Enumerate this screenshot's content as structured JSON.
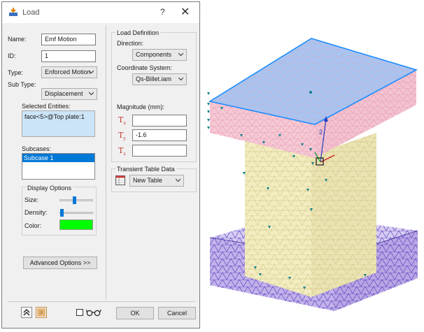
{
  "dialog": {
    "title": "Load",
    "help_glyph": "?",
    "close_glyph": "✕",
    "name_label": "Name:",
    "name_value": "Emf Motion",
    "id_label": "ID:",
    "id_value": "1",
    "type_label": "Type:",
    "type_value": "Enforced Motion",
    "subtype_label": "Sub Type:",
    "subtype_value": "Displacement",
    "selected_entities_label": "Selected Entities:",
    "selected_entities_value": "face<5>@Top plate:1",
    "subcases_label": "Subcases:",
    "subcases_items": [
      "Subcase 1"
    ],
    "display_options_label": "Display Options",
    "size_label": "Size:",
    "size_level": 0.45,
    "density_label": "Density:",
    "density_level": 0.02,
    "color_label": "Color:",
    "color_value": "#00ff00",
    "advanced_button": "Advanced Options >>",
    "load_definition_label": "Load Definition",
    "direction_label": "Direction:",
    "direction_value": "Components",
    "coord_system_label": "Coordinate System:",
    "coord_system_value": "Qs-Billet.iam",
    "magnitude_label": "Magnitude (mm):",
    "tx_label": "T",
    "tx_sub": "x",
    "tx_value": "",
    "ty_label": "T",
    "ty_sub": "y",
    "ty_value": "-1.6",
    "tz_label": "T",
    "tz_sub": "z",
    "tz_value": "",
    "transient_label": "Transient Table Data",
    "table_value": "New Table",
    "ok_button": "OK",
    "cancel_button": "Cancel"
  },
  "viewport": {
    "axis_label": "2",
    "colors": {
      "top_face": "#a8c4f0",
      "plate_side": "#f5c8d4",
      "column": "#f2ecc0",
      "base": "#c8b8ec",
      "edge_highlight": "#1a8cff"
    }
  }
}
